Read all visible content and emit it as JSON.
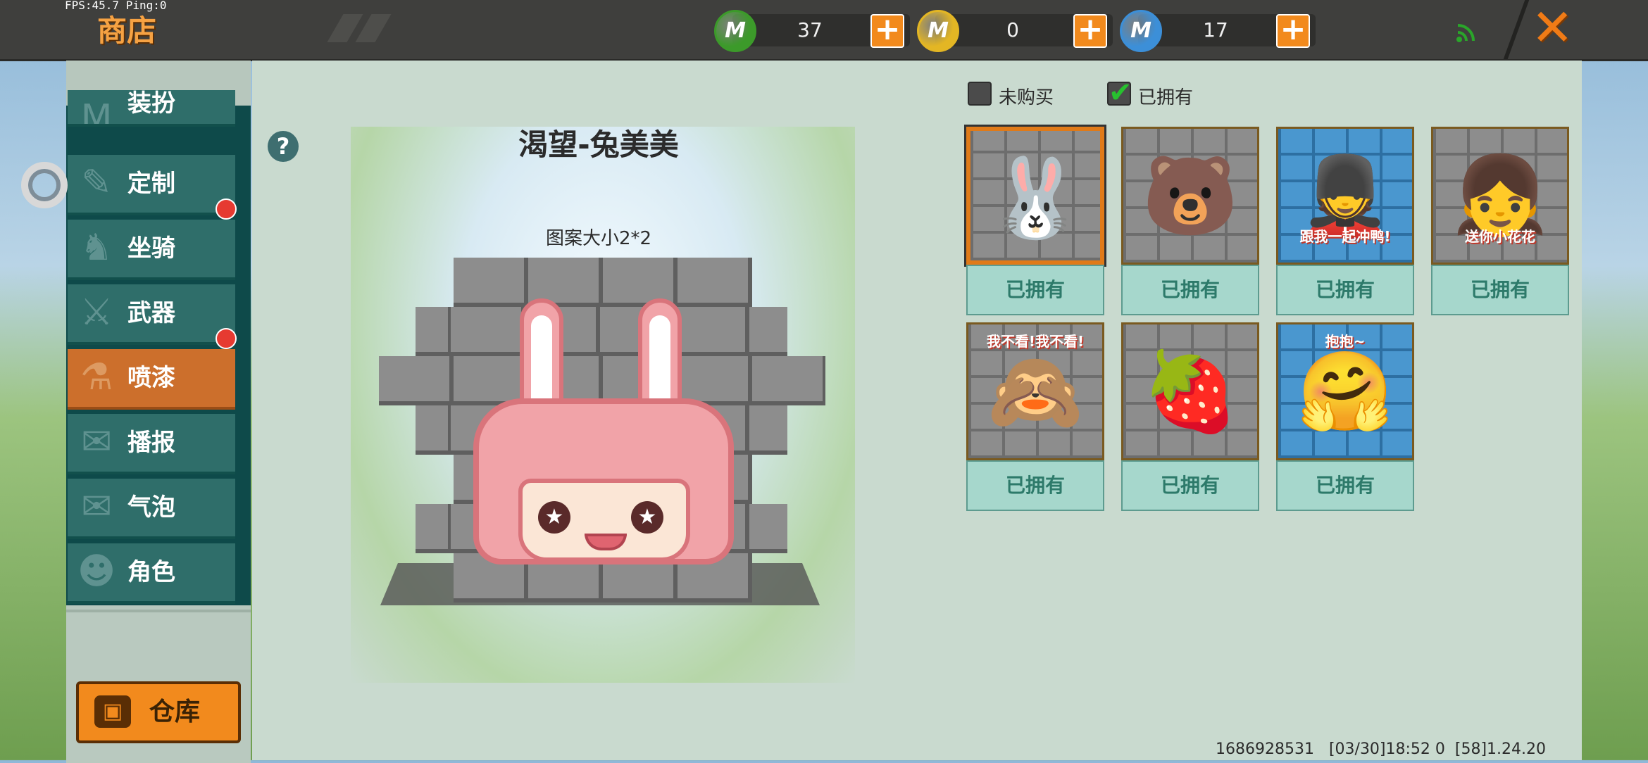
{
  "debug": {
    "fps_text": "FPS:45.7  Ping:0"
  },
  "header": {
    "title": "商店",
    "currencies": [
      {
        "icon": "green-mini-coin-icon",
        "symbol": "M",
        "color": "#3c9a2a",
        "value": "37"
      },
      {
        "icon": "gold-mini-coin-icon",
        "symbol": "M",
        "color": "#e3b624",
        "value": "0"
      },
      {
        "icon": "blue-mini-coin-icon",
        "symbol": "M",
        "color": "#3c8fd8",
        "value": "17"
      }
    ],
    "plus_symbol": "+",
    "close_symbol": "✕"
  },
  "sidebar": {
    "items": [
      {
        "label": "装扮",
        "icon": "costume-icon",
        "glyph": "M",
        "badge": false,
        "active": false
      },
      {
        "label": "定制",
        "icon": "customize-icon",
        "glyph": "✎",
        "badge": true,
        "active": false
      },
      {
        "label": "坐骑",
        "icon": "mount-icon",
        "glyph": "♞",
        "badge": false,
        "active": false
      },
      {
        "label": "武器",
        "icon": "weapon-icon",
        "glyph": "⚔",
        "badge": true,
        "active": false
      },
      {
        "label": "喷漆",
        "icon": "spray-can-icon",
        "glyph": "⚗",
        "badge": false,
        "active": true
      },
      {
        "label": "播报",
        "icon": "broadcast-icon",
        "glyph": "✉",
        "badge": false,
        "active": false
      },
      {
        "label": "气泡",
        "icon": "bubble-icon",
        "glyph": "✉",
        "badge": false,
        "active": false
      },
      {
        "label": "角色",
        "icon": "character-icon",
        "glyph": "☻",
        "badge": false,
        "active": false
      }
    ],
    "warehouse_label": "仓库",
    "warehouse_glyph": "▣"
  },
  "preview": {
    "help_symbol": "?",
    "item_title": "渴望-兔美美",
    "pattern_size": "图案大小2*2",
    "eye_glyph": "★"
  },
  "filters": {
    "not_purchased": {
      "label": "未购买",
      "checked": false
    },
    "owned": {
      "label": "已拥有",
      "checked": true,
      "check_glyph": "✔"
    }
  },
  "items": [
    {
      "name": "bunny-spray",
      "art": "🐰",
      "caption": "",
      "bg": "gray",
      "button": "已拥有",
      "selected": true
    },
    {
      "name": "bear-spray",
      "art": "🐻",
      "caption": "",
      "bg": "gray",
      "button": "已拥有",
      "selected": false
    },
    {
      "name": "soldier-spray",
      "art": "💂",
      "caption": "跟我一起冲鸭!",
      "bg": "blue",
      "button": "已拥有",
      "selected": false
    },
    {
      "name": "flower-girl-spray",
      "art": "👧",
      "caption": "送你小花花",
      "bg": "gray",
      "button": "已拥有",
      "selected": false
    },
    {
      "name": "purple-girl-spray",
      "art": "🙈",
      "caption": "我不看!我不看!",
      "bg": "gray",
      "button": "已拥有",
      "selected": false
    },
    {
      "name": "strawberry-girl-spray",
      "art": "🍓",
      "caption": "",
      "bg": "gray",
      "button": "已拥有",
      "selected": false
    },
    {
      "name": "hug-spray",
      "art": "🤗",
      "caption": "抱抱~",
      "bg": "blue",
      "button": "已拥有",
      "selected": false
    }
  ],
  "footer": {
    "info": "1686928531   [03/30]18:52 0  [58]1.24.20"
  }
}
